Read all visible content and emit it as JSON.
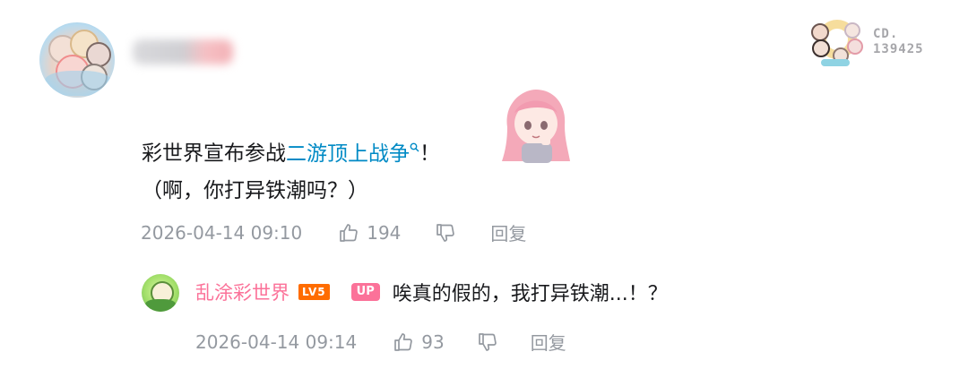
{
  "comment": {
    "text_line1_prefix": "彩世界宣布参战",
    "text_line1_link": "二游顶上战争",
    "text_line1_suffix": "！",
    "text_line2": "（啊，你打异铁潮吗？）",
    "search_icon": "search-icon",
    "time": "2026-04-14 09:10",
    "likes": "194",
    "reply_label": "回复"
  },
  "badge": {
    "line1": "CD.",
    "line2": "139425"
  },
  "reply": {
    "username": "乱涂彩世界",
    "level": "LV5",
    "up_tag": "UP",
    "text": "唉真的假的，我打异铁潮...！？",
    "time": "2026-04-14 09:14",
    "likes": "93",
    "reply_label": "回复"
  },
  "colors": {
    "link": "#008ac5",
    "meta": "#9499a0",
    "username_pink": "#fb7299",
    "level_orange": "#ff6c00"
  }
}
